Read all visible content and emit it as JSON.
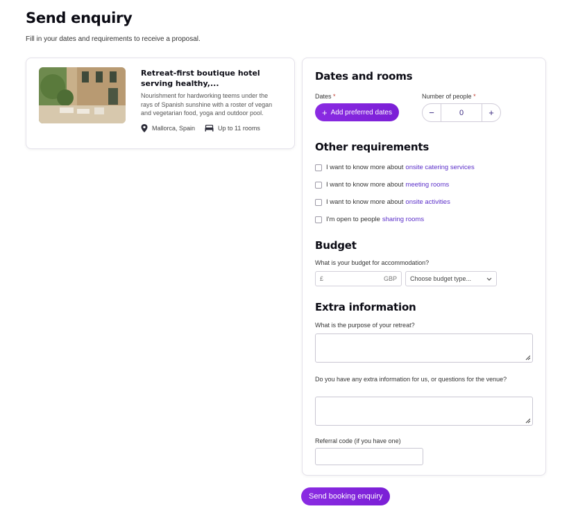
{
  "page": {
    "title": "Send enquiry",
    "subtitle": "Fill in your dates and requirements to receive a proposal."
  },
  "venue": {
    "title": "Retreat-first boutique hotel serving healthy,...",
    "description": "Nourishment for hardworking teems under the rays of Spanish sunshine with a roster of vegan and vegetarian food, yoga and outdoor pool.",
    "location": "Mallorca, Spain",
    "rooms": "Up to 11 rooms",
    "icons": {
      "location": "map-pin-icon",
      "rooms": "bed-icon"
    }
  },
  "dates_rooms": {
    "heading": "Dates and rooms",
    "dates_label": "Dates",
    "add_dates_label": "Add preferred dates",
    "people_label": "Number of people",
    "people_value": "0",
    "minus_label": "−",
    "plus_label": "+",
    "required_mark": "*"
  },
  "other_requirements": {
    "heading": "Other requirements",
    "items": [
      {
        "prefix": "I want to know more about",
        "link": "onsite catering services",
        "checked": false
      },
      {
        "prefix": "I want to know more about",
        "link": "meeting rooms",
        "checked": false
      },
      {
        "prefix": "I want to know more about",
        "link": "onsite activities",
        "checked": false
      },
      {
        "prefix": "I'm open to people",
        "link": "sharing rooms",
        "checked": false
      }
    ]
  },
  "budget": {
    "heading": "Budget",
    "question": "What is your budget for accommodation?",
    "currency_symbol": "£",
    "currency_code": "GBP",
    "type_placeholder": "Choose budget type..."
  },
  "extra": {
    "heading": "Extra information",
    "purpose_label": "What is the purpose of your retreat?",
    "questions_label": "Do you have any extra information for us, or questions for the venue?",
    "referral_label": "Referral code (if you have one)"
  },
  "submit_label": "Send booking enquiry",
  "colors": {
    "accent": "#7b1fd6",
    "link": "#5b2fc9"
  }
}
